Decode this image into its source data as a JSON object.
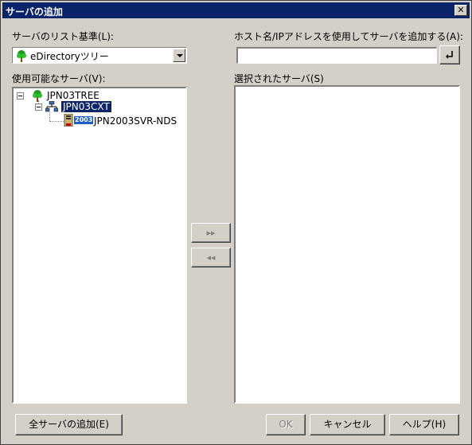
{
  "window": {
    "title": "サーバの追加",
    "close_label": "✕"
  },
  "list_basis": {
    "label": "サーバのリスト基準(L):",
    "selected": "eDirectoryツリー",
    "icon": "tree-icon"
  },
  "available": {
    "label": "使用可能なサーバ(V):",
    "tree": [
      {
        "label": "JPN03TREE",
        "icon": "tree-icon",
        "level": 0,
        "expanded": true
      },
      {
        "label": "JPN03CXT",
        "icon": "org-context-icon",
        "level": 1,
        "expanded": true,
        "selected": true
      },
      {
        "label": "JPN2003SVR-NDS",
        "icon": "server-icon",
        "badge": "2003",
        "level": 2
      }
    ]
  },
  "hostname": {
    "label": "ホスト名/IPアドレスを使用してサーバを追加する(A):",
    "value": "",
    "enter_icon": "enter-arrow-icon"
  },
  "selected_servers": {
    "label": "選択されたサーバ(S)",
    "items": []
  },
  "buttons": {
    "add_right": "▸▸",
    "remove_left": "◂◂",
    "add_all": "全サーバの追加(E)",
    "ok": "OK",
    "cancel": "キャンセル",
    "help": "ヘルプ(H)"
  }
}
